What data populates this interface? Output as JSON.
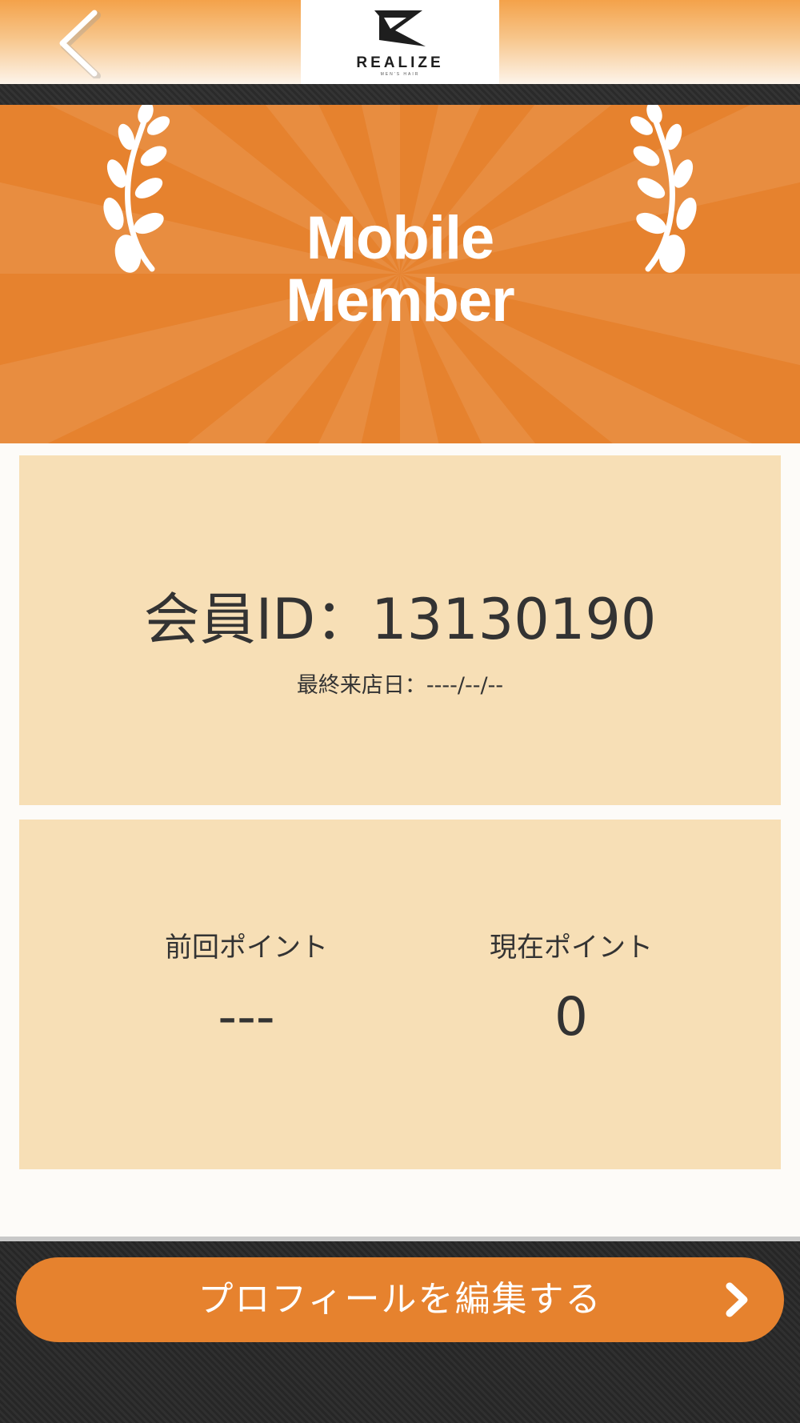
{
  "header": {
    "back_icon": "chevron-left-icon",
    "logo_text": "REALIZE",
    "logo_sub": "MEN'S HAIR"
  },
  "banner": {
    "title_line1": "Mobile",
    "title_line2": "Member",
    "left_icon": "laurel-left-icon",
    "right_icon": "laurel-right-icon"
  },
  "member_card": {
    "member_id": "会員ID：13130190",
    "last_visit": "最終来店日：----/--/--"
  },
  "points_card": {
    "previous_label": "前回ポイント",
    "previous_value": "---",
    "current_label": "現在ポイント",
    "current_value": "0"
  },
  "footer": {
    "edit_button_label": "プロフィールを編集する",
    "edit_button_icon": "chevron-right-icon"
  },
  "colors": {
    "accent": "#e6822e",
    "card_bg": "#f7dfb6",
    "text": "#333333"
  }
}
